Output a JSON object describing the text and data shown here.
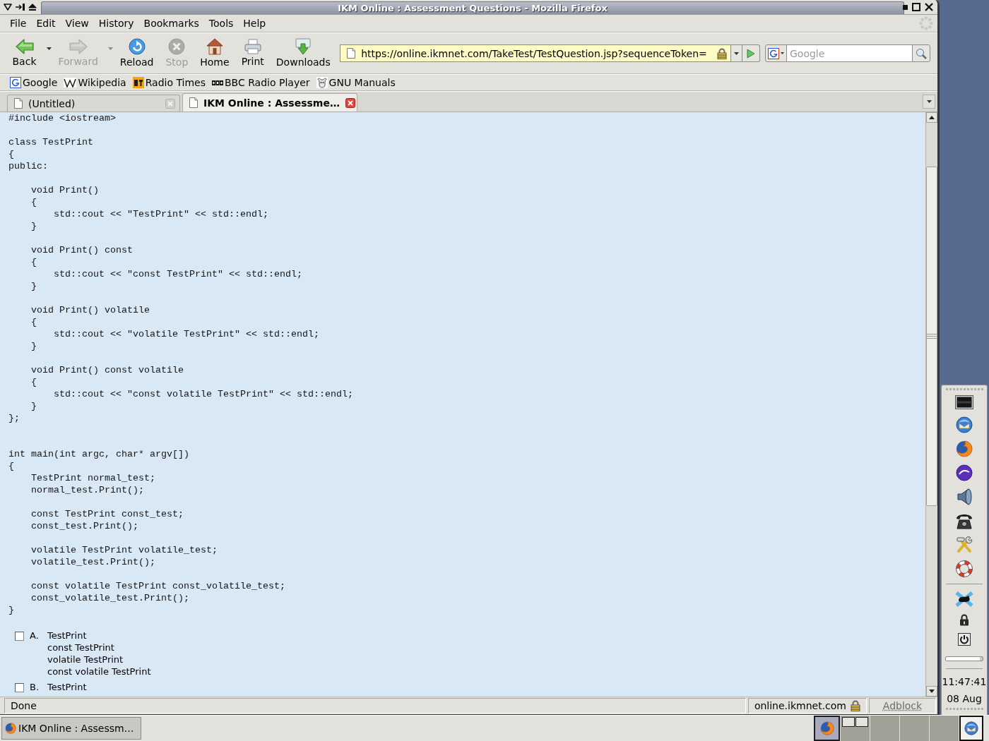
{
  "window": {
    "title": "IKM Online : Assessment Questions - Mozilla Firefox"
  },
  "menu_bar": [
    "File",
    "Edit",
    "View",
    "History",
    "Bookmarks",
    "Tools",
    "Help"
  ],
  "toolbar": [
    {
      "label": "Back",
      "kind": "back",
      "disabled": false,
      "dropdown": true
    },
    {
      "label": "Forward",
      "kind": "forward",
      "disabled": true,
      "dropdown": true
    },
    {
      "label": "Reload",
      "kind": "reload",
      "disabled": false,
      "dropdown": false
    },
    {
      "label": "Stop",
      "kind": "stop",
      "disabled": true,
      "dropdown": false
    },
    {
      "label": "Home",
      "kind": "home",
      "disabled": false,
      "dropdown": false
    },
    {
      "label": "Print",
      "kind": "print",
      "disabled": false,
      "dropdown": false
    },
    {
      "label": "Downloads",
      "kind": "downloads",
      "disabled": false,
      "dropdown": false
    }
  ],
  "address_bar": {
    "value": "https://online.ikmnet.com/TakeTest/TestQuestion.jsp?sequenceToken=",
    "secure": true
  },
  "search": {
    "placeholder": "Google"
  },
  "bookmarks": [
    {
      "label": "Google",
      "kind": "google"
    },
    {
      "label": "Wikipedia",
      "kind": "wikipedia"
    },
    {
      "label": "Radio Times",
      "kind": "radio_times"
    },
    {
      "label": "BBC Radio Player",
      "kind": "bbc"
    },
    {
      "label": "GNU Manuals",
      "kind": "gnu"
    }
  ],
  "tabs": [
    {
      "label": "(Untitled)",
      "selected": false
    },
    {
      "label": "IKM Online : Assessme…",
      "selected": true
    }
  ],
  "page": {
    "code": "#include <iostream>\n\nclass TestPrint\n{\npublic:\n\n    void Print()\n    {\n        std::cout << \"TestPrint\" << std::endl;\n    }\n\n    void Print() const\n    {\n        std::cout << \"const TestPrint\" << std::endl;\n    }\n\n    void Print() volatile\n    {\n        std::cout << \"volatile TestPrint\" << std::endl;\n    }\n\n    void Print() const volatile\n    {\n        std::cout << \"const volatile TestPrint\" << std::endl;\n    }\n};\n\n\nint main(int argc, char* argv[])\n{\n    TestPrint normal_test;\n    normal_test.Print();\n\n    const TestPrint const_test;\n    const_test.Print();\n\n    volatile TestPrint volatile_test;\n    volatile_test.Print();\n\n    const volatile TestPrint const_volatile_test;\n    const_volatile_test.Print();\n}",
    "answers": [
      {
        "letter": "A.",
        "text": "TestPrint\nconst TestPrint\nvolatile TestPrint\nconst volatile TestPrint",
        "checked": false
      },
      {
        "letter": "B.",
        "text": "TestPrint",
        "checked": false
      }
    ]
  },
  "status_bar": {
    "status": "Done",
    "host": "online.ikmnet.com",
    "secure": true,
    "addon": "Adblock"
  },
  "dock": {
    "items": [
      {
        "kind": "terminal"
      },
      {
        "kind": "mail"
      },
      {
        "kind": "browser"
      },
      {
        "kind": "editor"
      },
      {
        "kind": "speaker"
      },
      {
        "kind": "phone"
      },
      {
        "kind": "tools"
      },
      {
        "kind": "help"
      },
      {
        "kind": "separator"
      },
      {
        "kind": "mouse"
      },
      {
        "kind": "lock"
      },
      {
        "kind": "power"
      },
      {
        "kind": "meter"
      },
      {
        "kind": "separator"
      }
    ],
    "clock": "11:47:41",
    "date": "08 Aug"
  },
  "taskbar": {
    "tasks": [
      {
        "label": "IKM Online : Assessm…",
        "selected": true
      }
    ],
    "launchers": [
      {
        "kind": "browser",
        "selected": true
      }
    ],
    "workspaces": [
      {
        "kind": "occupied"
      },
      {
        "kind": "empty"
      },
      {
        "kind": "empty"
      },
      {
        "kind": "empty"
      }
    ],
    "tray": [
      {
        "kind": "mail"
      }
    ]
  }
}
